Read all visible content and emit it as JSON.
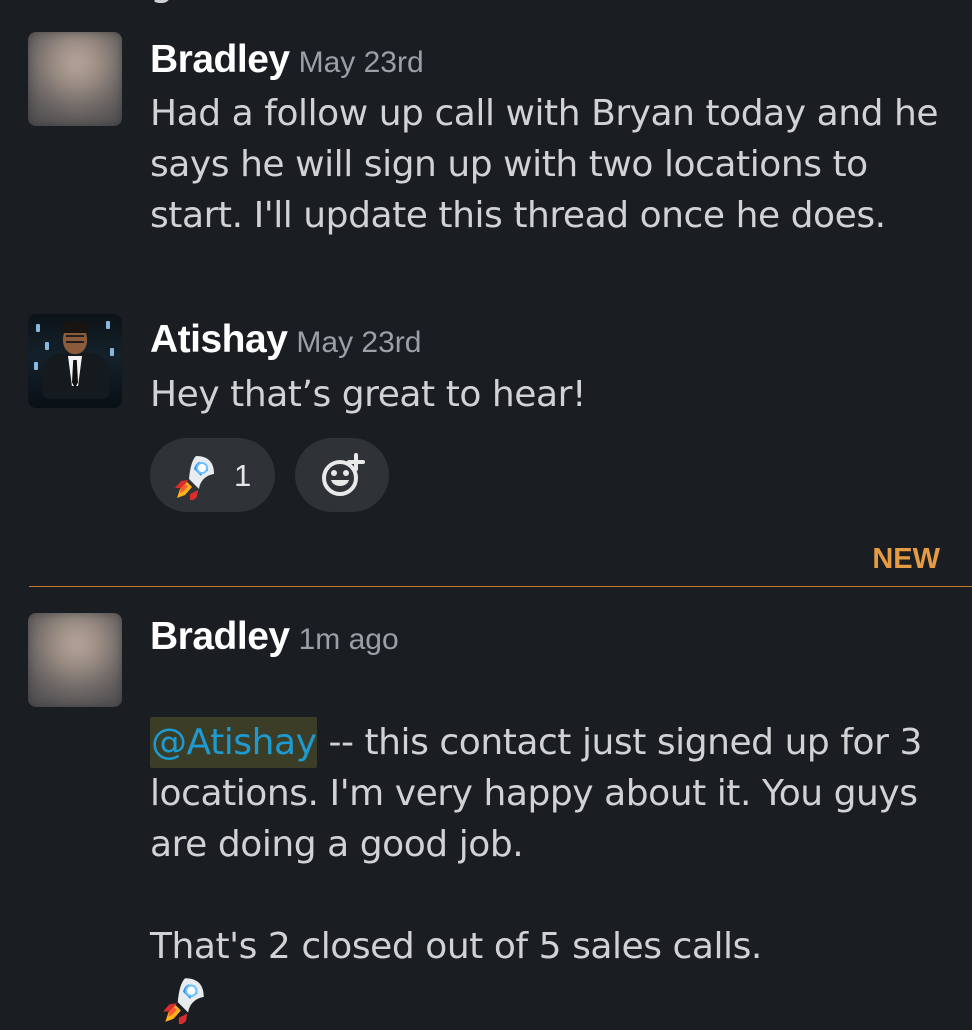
{
  "partial_previous_text": "g",
  "messages": [
    {
      "author": "Bradley",
      "time": "May 23rd",
      "body": "Had a follow up call with Bryan today and he says he will sign up with two locations to start. I'll update this thread once he does."
    },
    {
      "author": "Atishay",
      "time": "May 23rd",
      "body": "Hey that’s great to hear!",
      "reactions": [
        {
          "emoji": "🚀",
          "count": "1",
          "icon": "rocket-icon"
        }
      ],
      "add_reaction_icon": "add-reaction-icon"
    },
    {
      "author": "Bradley",
      "time": "1m ago",
      "mention": "@Atishay",
      "body_after_mention": " -- this contact just signed up for 3 locations. I'm very happy about it. You guys are doing a good job.",
      "body_second_paragraph": "That's 2 closed out of 5 sales calls.",
      "inline_emoji": "🚀",
      "inline_icon": "rocket-icon"
    }
  ],
  "divider": {
    "label": "NEW",
    "color": "#c27927",
    "label_color": "#e59b43"
  },
  "colors": {
    "background": "#1a1d21",
    "text": "#d1d2d3",
    "author": "#ffffff",
    "timestamp": "#9aa0a6",
    "reaction_background": "#2f3236",
    "mention": "#1d9bd1",
    "mention_background": "#3c3d27"
  }
}
